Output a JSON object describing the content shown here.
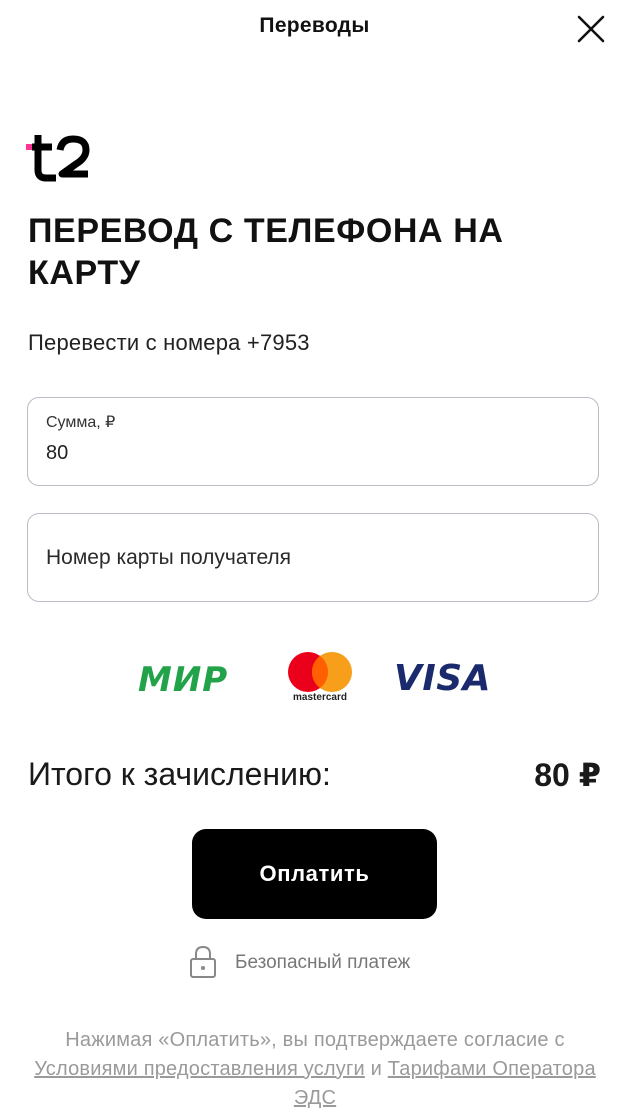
{
  "header": {
    "title": "Переводы",
    "close_icon": "close-icon"
  },
  "brand": {
    "logo_icon": "t2-logo",
    "accent_color": "#ff3495"
  },
  "main": {
    "title": "ПЕРЕВОД С ТЕЛЕФОНА НА КАРТУ",
    "from_number": "Перевести с номера +7953",
    "amount_field": {
      "label": "Сумма, ₽",
      "value": "80"
    },
    "card_field": {
      "placeholder": "Номер карты получателя"
    },
    "payment_systems": {
      "mir": "МИР",
      "mastercard": "mastercard",
      "visa": "VISA"
    },
    "total": {
      "label": "Итого к зачислению:",
      "value": "80 ₽"
    },
    "pay_button": "Оплатить",
    "secure_label": "Безопасный платеж",
    "legal": {
      "prefix": "Нажимая «Оплатить», вы подтверждаете согласие с",
      "link1": "Условиями предоставления услуги",
      "middle": "и",
      "link2": "Тарифами Оператора ЭДС"
    }
  }
}
